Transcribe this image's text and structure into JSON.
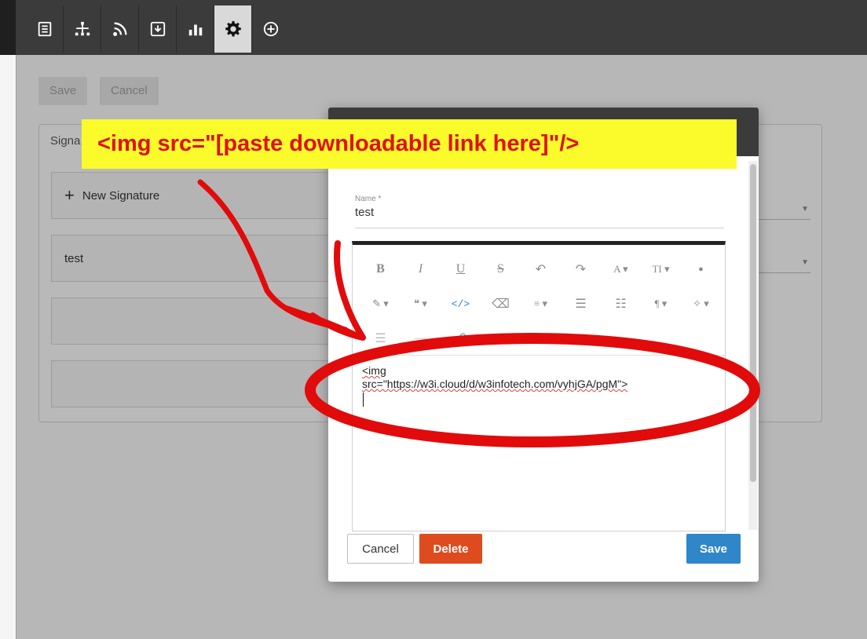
{
  "toolbar": {
    "icons": [
      "document-list-icon",
      "sitemap-icon",
      "rss-feed-icon",
      "download-box-icon",
      "bar-chart-icon",
      "gear-icon",
      "add-circle-icon"
    ],
    "active": "gear-icon"
  },
  "page": {
    "save_label": "Save",
    "cancel_label": "Cancel",
    "panel_title": "Signa",
    "new_signature_label": "New Signature",
    "items": [
      "test",
      "",
      ""
    ]
  },
  "annotation": {
    "banner_text": "<img src=\"[paste downloadable link here]\"/>"
  },
  "modal": {
    "name_label": "Name *",
    "name_value": "test",
    "editor": {
      "row1": [
        "B",
        "I",
        "U",
        "S",
        "↶",
        "↷",
        "A ▾",
        "TI ▾",
        "●"
      ],
      "row2": [
        "✎ ▾",
        "❝ ▾",
        "</>",
        "⌫",
        "≡ ▾",
        "☰",
        "☷",
        "¶ ▾",
        "✧ ▾"
      ],
      "row3": [
        "☰",
        "―",
        "🔗",
        "◦",
        "■",
        "▦"
      ],
      "code_line1": "<img",
      "code_line2": "src=\"https://w3i.cloud/d/w3infotech.com/vyhjGA/pgM\">"
    },
    "cancel_label": "Cancel",
    "delete_label": "Delete",
    "save_label": "Save"
  },
  "colors": {
    "topbar": "#3b3b3b",
    "banner_bg": "#fbfb2b",
    "banner_text": "#e01010",
    "annotation_red": "#e10b0b",
    "delete": "#dd4b1f",
    "save": "#2f86c9"
  }
}
